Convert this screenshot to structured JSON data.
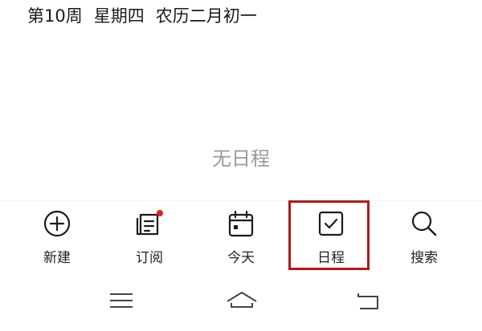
{
  "header": {
    "week": "第10周",
    "weekday": "星期四",
    "lunar": "农历二月初一"
  },
  "main": {
    "empty_text": "无日程"
  },
  "toolbar": {
    "items": [
      {
        "label": "新建",
        "icon": "plus-circle-icon"
      },
      {
        "label": "订阅",
        "icon": "subscribe-icon"
      },
      {
        "label": "今天",
        "icon": "calendar-today-icon"
      },
      {
        "label": "日程",
        "icon": "schedule-check-icon"
      },
      {
        "label": "搜索",
        "icon": "search-icon"
      }
    ],
    "notification_dot_color": "#e02020",
    "highlight_color": "#b01a1a"
  },
  "navbar": {
    "buttons": [
      "menu-icon",
      "home-icon",
      "back-icon"
    ]
  }
}
